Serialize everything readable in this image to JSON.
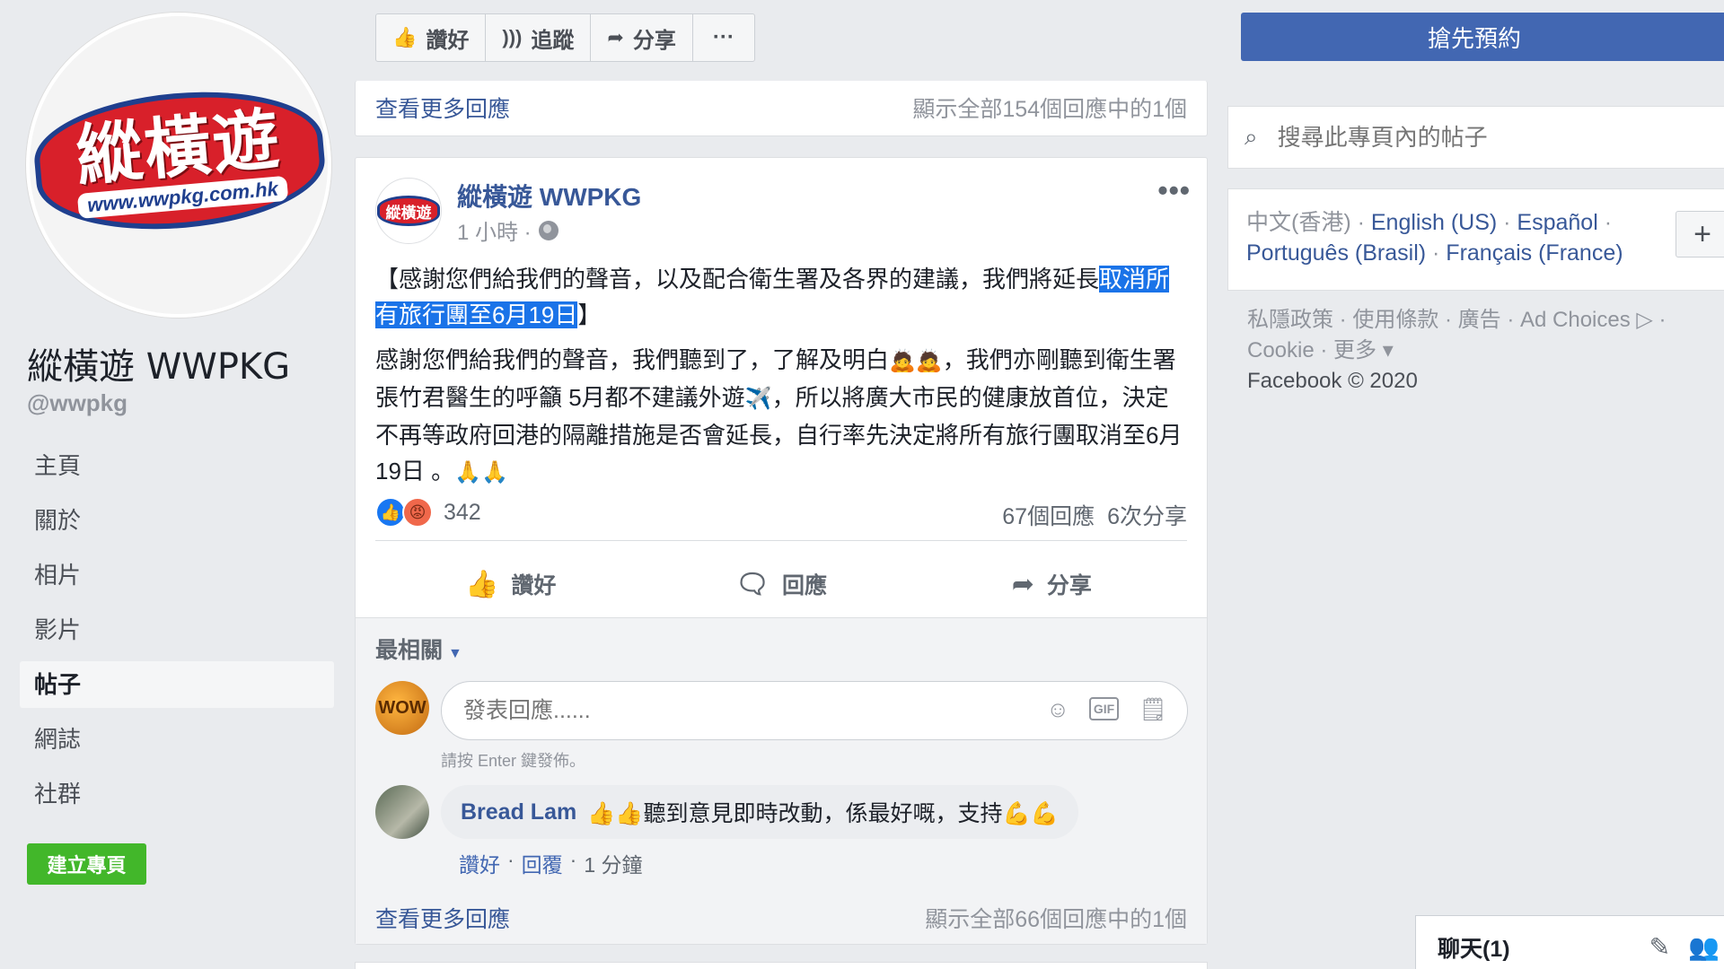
{
  "profile": {
    "logo_text": "縱橫遊",
    "logo_url_text": "www.wwpkg.com.hk",
    "name": "縱橫遊 WWPKG",
    "handle": "@wwpkg"
  },
  "nav": {
    "items": [
      {
        "label": "主頁"
      },
      {
        "label": "關於"
      },
      {
        "label": "相片"
      },
      {
        "label": "影片"
      },
      {
        "label": "帖子"
      },
      {
        "label": "網誌"
      },
      {
        "label": "社群"
      }
    ],
    "active": "帖子",
    "create_page": "建立專頁"
  },
  "page_actions": {
    "like": "讚好",
    "follow": "追蹤",
    "share": "分享",
    "more": "···"
  },
  "prev_post": {
    "view_more": "查看更多回應",
    "count_text": "顯示全部154個回應中的1個"
  },
  "post": {
    "author": "縱橫遊 WWPKG",
    "avatar_text": "縱橫遊",
    "time": "1 小時 ·",
    "more": "•••",
    "headline_before": "【感謝您們給我們的聲音，以及配合衛生署及各界的建議，我們將延長",
    "headline_selected": "取消所有旅行團至6月19日",
    "headline_after": "】",
    "body_1": "感謝您們給我們的聲音，我們聽到了，了解及明白",
    "body_1_emoji": "🙇🙇",
    "body_2": "，我們亦剛聽到衛生署張竹君醫生的呼籲 5月都不建議外遊",
    "body_2_emoji": "✈️",
    "body_3": "，所以將廣大市民的健康放首位，決定不再等政府回港的隔離措施是否會延長，自行率先決定將所有旅行團取消至6月19日 。",
    "body_3_emoji": "🙏🙏",
    "reaction_count": "342",
    "comments_count": "67個回應",
    "shares_count": "6次分享",
    "actions": {
      "like": "讚好",
      "comment": "回應",
      "share": "分享"
    }
  },
  "comments": {
    "sort_label": "最相關",
    "me_avatar_text": "WOW",
    "input_placeholder": "發表回應......",
    "gif_label": "GIF",
    "enter_hint": "請按 Enter 鍵發佈。",
    "items": [
      {
        "author": "Bread Lam",
        "text": "👍👍聽到意見即時改動，係最好嘅，支持💪💪",
        "like": "讚好",
        "reply": "回覆",
        "time": "1 分鐘"
      }
    ],
    "view_more": "查看更多回應",
    "count_text": "顯示全部66個回應中的1個"
  },
  "sidebar_right": {
    "reserve_button": "搶先預約",
    "search_placeholder": "搜尋此專頁內的帖子",
    "lang_current": "中文(香港)",
    "languages": [
      "English (US)",
      "Español",
      "Português (Brasil)",
      "Français (France)"
    ],
    "footer_links": [
      "私隱政策",
      "使用條款",
      "廣告",
      "Ad Choices"
    ],
    "footer_links_2": [
      "Cookie",
      "更多"
    ],
    "copyright": "Facebook © 2020"
  },
  "chat": {
    "label": "聊天(1)"
  }
}
